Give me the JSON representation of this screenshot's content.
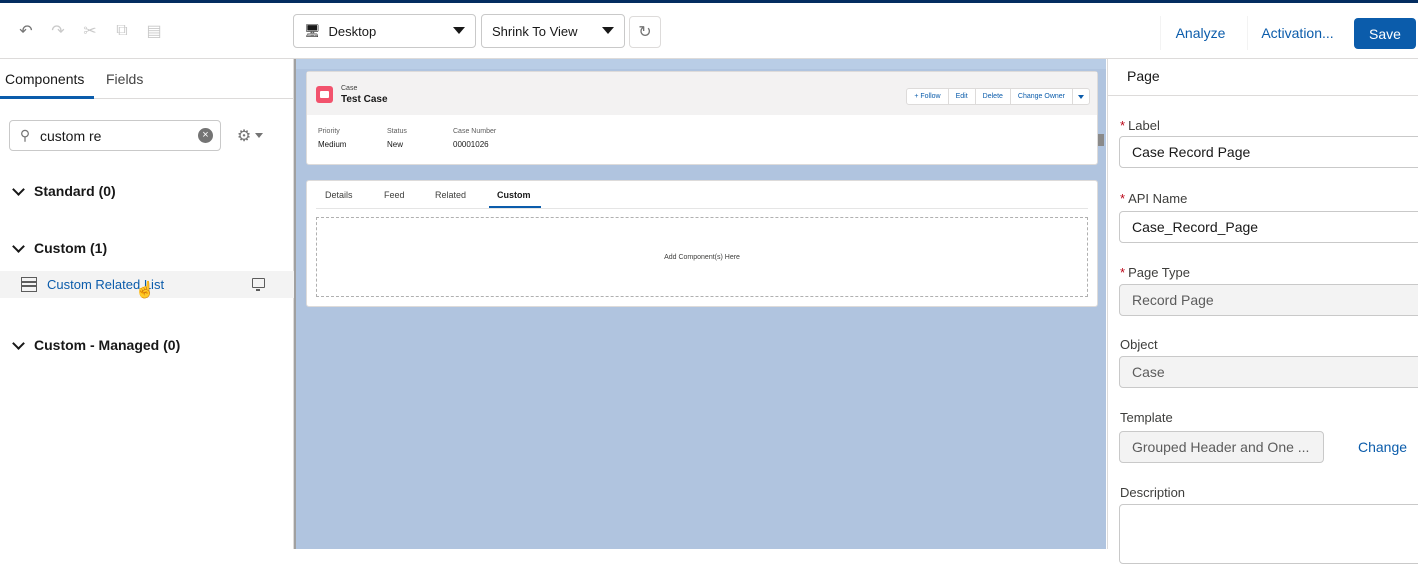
{
  "toolbar": {
    "undo_icon": "undo-icon",
    "redo_icon": "redo-icon",
    "cut_icon": "cut-icon",
    "copy_icon": "copy-icon",
    "paste_icon": "paste-icon",
    "device_select": "Desktop",
    "view_select": "Shrink To View",
    "refresh_icon": "refresh-icon",
    "analyze_label": "Analyze",
    "activation_label": "Activation...",
    "save_label": "Save",
    "accent_color": "#0b5cab"
  },
  "left_panel": {
    "tabs": [
      "Components",
      "Fields"
    ],
    "search_value": "custom re",
    "sections": [
      {
        "label": "Standard (0)"
      },
      {
        "label": "Custom (1)"
      },
      {
        "label": "Custom - Managed (0)"
      }
    ],
    "components": [
      {
        "label": "Custom Related List"
      }
    ]
  },
  "canvas": {
    "object_label": "Case",
    "record_title": "Test Case",
    "actions": [
      "+ Follow",
      "Edit",
      "Delete",
      "Change Owner"
    ],
    "fields": [
      {
        "label": "Priority",
        "value": "Medium"
      },
      {
        "label": "Status",
        "value": "New"
      },
      {
        "label": "Case Number",
        "value": "00001026"
      }
    ],
    "tabs": [
      "Details",
      "Feed",
      "Related",
      "Custom"
    ],
    "active_tab": "Custom",
    "dropzone_text": "Add Component(s) Here",
    "background_color": "#b0c4df"
  },
  "right_panel": {
    "title": "Page",
    "label_field": {
      "label": "Label",
      "value": "Case Record Page"
    },
    "api_field": {
      "label": "API Name",
      "value": "Case_Record_Page"
    },
    "page_type_field": {
      "label": "Page Type",
      "value": "Record Page"
    },
    "object_field": {
      "label": "Object",
      "value": "Case"
    },
    "template_field": {
      "label": "Template",
      "value": "Grouped Header and One ...",
      "change_label": "Change"
    },
    "description_field": {
      "label": "Description",
      "value": ""
    }
  }
}
